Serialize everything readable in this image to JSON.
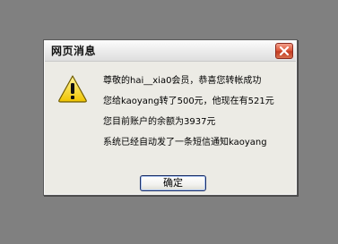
{
  "dialog": {
    "title": "网页消息",
    "icon": "warning-icon",
    "close_icon": "close-icon",
    "lines": [
      "尊敬的hai__xia0会员，恭喜您转帐成功",
      "您给kaoyang转了500元，他现在有521元",
      "您目前账户的余额为3937元",
      "系统已经自动发了一条短信通知kaoyang"
    ],
    "ok_label": "确定"
  }
}
